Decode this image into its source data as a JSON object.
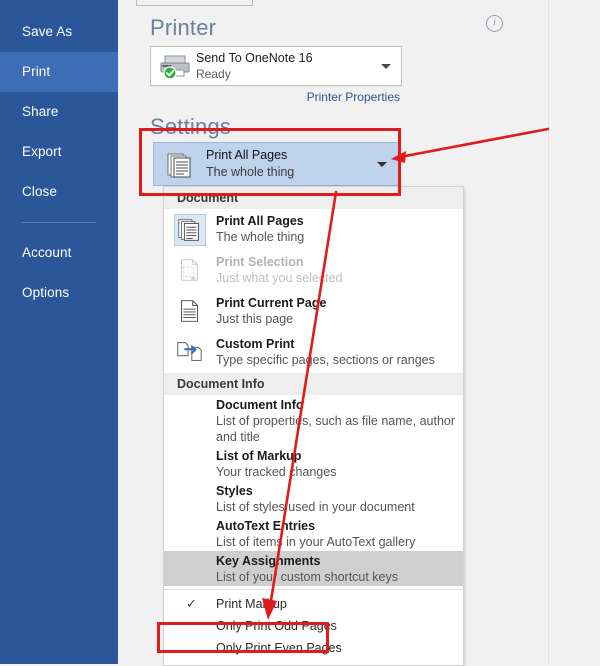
{
  "sidebar": {
    "items": [
      {
        "label": "Save As",
        "active": false
      },
      {
        "label": "Print",
        "active": true
      },
      {
        "label": "Share",
        "active": false
      },
      {
        "label": "Export",
        "active": false
      },
      {
        "label": "Close",
        "active": false
      },
      {
        "label": "Account",
        "active": false
      },
      {
        "label": "Options",
        "active": false
      }
    ]
  },
  "printer_section": {
    "title": "Printer",
    "info_icon": "info-icon",
    "info_glyph": "i",
    "printer_name": "Send To OneNote 16",
    "printer_status": "Ready",
    "printer_icon": "printer-icon",
    "status_badge": "green-check-badge",
    "properties_link": "Printer Properties",
    "dropdown_caret": "chevron-down-icon"
  },
  "settings_section": {
    "title": "Settings",
    "selected_option": "Print All Pages",
    "selected_subtitle": "The whole thing",
    "icon": "print-all-pages-icon",
    "dropdown_caret": "chevron-down-icon"
  },
  "dropdown": {
    "groups": [
      {
        "header": "Document",
        "items": [
          {
            "title": "Print All Pages",
            "subtitle": "The whole thing",
            "icon": "print-all-pages-icon",
            "state": "current",
            "disabled": false
          },
          {
            "title": "Print Selection",
            "subtitle": "Just what you selected",
            "icon": "print-selection-icon",
            "state": "disabled",
            "disabled": true
          },
          {
            "title": "Print Current Page",
            "subtitle": "Just this page",
            "icon": "print-current-page-icon",
            "state": "normal",
            "disabled": false
          },
          {
            "title": "Custom Print",
            "subtitle": "Type specific pages, sections or ranges",
            "icon": "custom-print-icon",
            "state": "normal",
            "disabled": false
          }
        ]
      },
      {
        "header": "Document Info",
        "items": [
          {
            "title": "Document Info",
            "subtitle": "List of properties, such as file name, author and title",
            "icon": "",
            "state": "normal",
            "disabled": false
          },
          {
            "title": "List of Markup",
            "subtitle": "Your tracked changes",
            "icon": "",
            "state": "normal",
            "disabled": false
          },
          {
            "title": "Styles",
            "subtitle": "List of styles used in your document",
            "icon": "",
            "state": "normal",
            "disabled": false
          },
          {
            "title": "AutoText Entries",
            "subtitle": "List of items in your AutoText gallery",
            "icon": "",
            "state": "normal",
            "disabled": false
          },
          {
            "title": "Key Assignments",
            "subtitle": "List of your custom shortcut keys",
            "icon": "",
            "state": "hover",
            "disabled": false
          }
        ]
      }
    ],
    "toggles": [
      {
        "label": "Print Markup",
        "checked": true,
        "check_glyph": "✓"
      },
      {
        "label": "Only Print Odd Pages",
        "checked": false,
        "check_glyph": ""
      },
      {
        "label": "Only Print Even Pages",
        "checked": false,
        "check_glyph": ""
      }
    ]
  },
  "annotations": {
    "color": "#e01b1b",
    "highlight_settings_label": "Settings print-range dropdown highlight",
    "highlight_even_label": "Only Print Even Pages highlight",
    "arrow_to_settings": "arrow pointing to Settings dropdown",
    "arrow_to_even": "arrow pointing to Only Print Even Pages"
  }
}
